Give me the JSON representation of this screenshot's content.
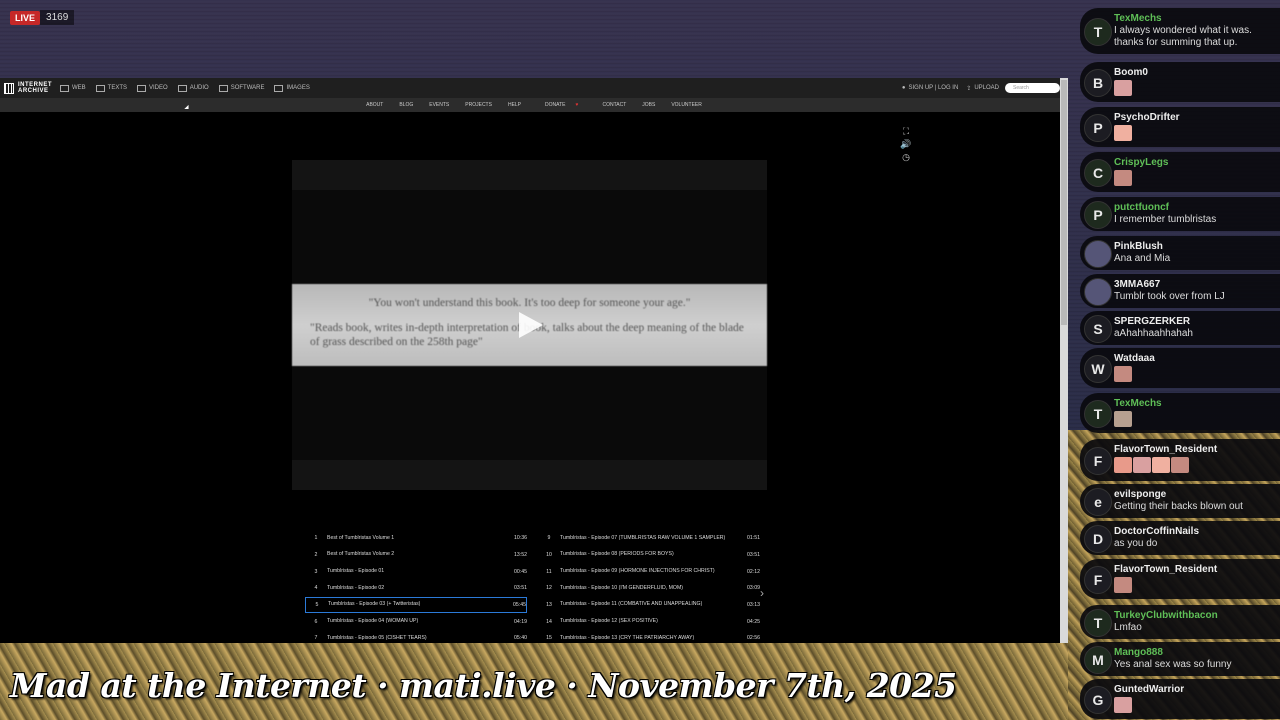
{
  "stream": {
    "live_label": "LIVE",
    "viewer_count": "3169",
    "overlay_title": "Mad at the Internet · mati.live · November 7th, 2025"
  },
  "archive": {
    "logo_line1": "INTERNET",
    "logo_line2": "ARCHIVE",
    "nav": [
      "WEB",
      "TEXTS",
      "VIDEO",
      "AUDIO",
      "SOFTWARE",
      "IMAGES"
    ],
    "signup": "SIGN UP | LOG IN",
    "upload": "UPLOAD",
    "search_placeholder": "Search",
    "subnav": [
      "ABOUT",
      "BLOG",
      "EVENTS",
      "PROJECTS",
      "HELP",
      "DONATE",
      "CONTACT",
      "JOBS",
      "VOLUNTEER"
    ],
    "controls": {
      "fullscreen": "⛶",
      "volume": "🔊",
      "speed": "◷"
    }
  },
  "video": {
    "quote1": "\"You won't understand this book. It's too deep for someone your age.\"",
    "quote2": "\"Reads book, writes in-depth interpretation of book, talks about the deep meaning of the blade of grass described on the 258th page\""
  },
  "playlist": {
    "left": [
      {
        "n": "1",
        "t": "Best of Tumblristas Volume 1",
        "d": "10:36"
      },
      {
        "n": "2",
        "t": "Best of Tumblristas Volume 2",
        "d": "13:52"
      },
      {
        "n": "3",
        "t": "Tumblristas - Episode 01",
        "d": "00:45"
      },
      {
        "n": "4",
        "t": "Tumblristas - Episode 02",
        "d": "03:51"
      },
      {
        "n": "5",
        "t": "Tumblristas - Episode 03 (+ Twitteristas)",
        "d": "05:45"
      },
      {
        "n": "6",
        "t": "Tumblristas - Episode 04 (WOMAN UP)",
        "d": "04:19"
      },
      {
        "n": "7",
        "t": "Tumblristas - Episode 05 (CISHET TEARS)",
        "d": "05:40"
      }
    ],
    "right": [
      {
        "n": "9",
        "t": "Tumblristas - Episode 07 (TUMBLRISTAS RAW VOLUME 1 SAMPLER)",
        "d": "01:51"
      },
      {
        "n": "10",
        "t": "Tumblristas - Episode 08 (PERIODS FOR BOYS)",
        "d": "03:51"
      },
      {
        "n": "11",
        "t": "Tumblristas - Episode 09 (HORMONE INJECTIONS FOR CHRIST)",
        "d": "02:12"
      },
      {
        "n": "12",
        "t": "Tumblristas - Episode 10 (I'M GENDERFLUID, MOM)",
        "d": "03:09"
      },
      {
        "n": "13",
        "t": "Tumblristas - Episode 11 (COMBATIVE AND UNAPPEALING)",
        "d": "03:13"
      },
      {
        "n": "14",
        "t": "Tumblristas - Episode 12 (SEX POSITIVE)",
        "d": "04:25"
      },
      {
        "n": "15",
        "t": "Tumblristas - Episode 13 (CRY THE PATRIARCHY AWAY)",
        "d": "02:56"
      }
    ],
    "selected_index": 4,
    "next_icon": "›"
  },
  "chat": [
    {
      "user": "TexMechs",
      "text": "I always wondered what it was. thanks for summing that up.",
      "initial": "T",
      "green": true,
      "emotes": 0
    },
    {
      "user": "Boom0",
      "text": "",
      "initial": "B",
      "green": false,
      "emotes": 1
    },
    {
      "user": "PsychoDrifter",
      "text": "",
      "initial": "P",
      "green": false,
      "emotes": 1
    },
    {
      "user": "CrispyLegs",
      "text": "",
      "initial": "C",
      "green": true,
      "emotes": 1
    },
    {
      "user": "putctfuoncf",
      "text": "I remember tumblristas",
      "initial": "P",
      "green": true,
      "emotes": 0
    },
    {
      "user": "PinkBlush",
      "text": "Ana and Mia",
      "initial": "",
      "green": false,
      "emotes": 0
    },
    {
      "user": "3MMA667",
      "text": "Tumblr took over from LJ",
      "initial": "",
      "green": false,
      "emotes": 0
    },
    {
      "user": "SPERGZERKER",
      "text": "aAhahhaahhahah",
      "initial": "S",
      "green": false,
      "emotes": 0
    },
    {
      "user": "Watdaaa",
      "text": "",
      "initial": "W",
      "green": false,
      "emotes": 1
    },
    {
      "user": "TexMechs",
      "text": "",
      "initial": "T",
      "green": true,
      "emotes": 1
    },
    {
      "user": "FlavorTown_Resident",
      "text": "",
      "initial": "F",
      "green": false,
      "emotes": 4
    },
    {
      "user": "evilsponge",
      "text": "Getting their backs blown out",
      "initial": "e",
      "green": false,
      "emotes": 0
    },
    {
      "user": "DoctorCoffinNails",
      "text": "as you do",
      "initial": "D",
      "green": false,
      "emotes": 0
    },
    {
      "user": "FlavorTown_Resident",
      "text": "",
      "initial": "F",
      "green": false,
      "emotes": 1
    },
    {
      "user": "TurkeyClubwithbacon",
      "text": "Lmfao",
      "initial": "T",
      "green": true,
      "emotes": 0
    },
    {
      "user": "Mango888",
      "text": "Yes anal sex was so funny",
      "initial": "M",
      "green": true,
      "emotes": 0
    },
    {
      "user": "GuntedWarrior",
      "text": "",
      "initial": "G",
      "green": false,
      "emotes": 1
    }
  ],
  "colors": {
    "accent_green": "#5fbf57",
    "live_red": "#c62828",
    "selection_blue": "#2b7ad8"
  }
}
